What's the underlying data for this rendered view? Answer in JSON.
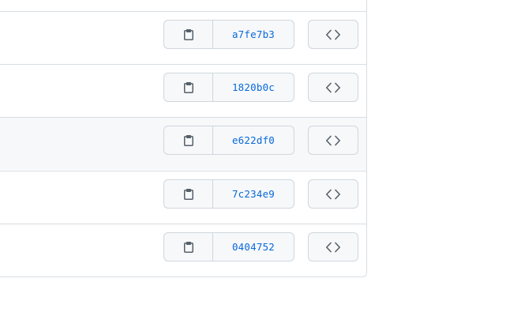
{
  "commits": [
    {
      "sha": "a7fe7b3",
      "hovered": false
    },
    {
      "sha": "1820b0c",
      "hovered": false
    },
    {
      "sha": "e622df0",
      "hovered": true
    },
    {
      "sha": "7c234e9",
      "hovered": false
    },
    {
      "sha": "0404752",
      "hovered": false
    }
  ],
  "icons": {
    "copy": "clipboard-icon",
    "browse": "code-icon"
  },
  "colors": {
    "link": "#0969da",
    "border": "#d0d7de",
    "row_hover": "#f6f8fa",
    "icon": "#57606a"
  }
}
